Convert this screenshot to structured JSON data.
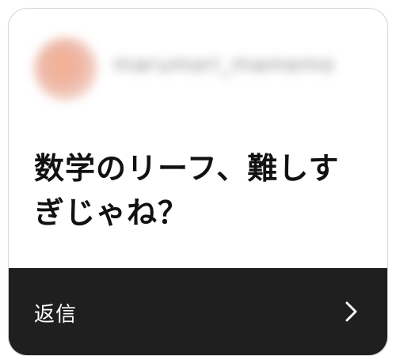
{
  "post": {
    "username": "marumori_mamemo",
    "message": "数学のリーフ、難しすぎじゃね？"
  },
  "reply": {
    "label": "返信"
  },
  "icons": {
    "avatar": "avatar",
    "reply_arrow": "chevron-right-icon"
  },
  "colors": {
    "reply_bar": "#1f1f1f",
    "text": "#111111"
  }
}
